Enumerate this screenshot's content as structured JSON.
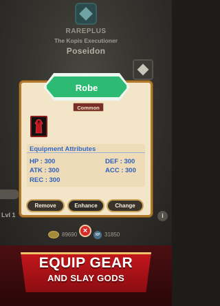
{
  "background": {
    "rarity": "RAREPLUS",
    "subtitle": "The Kopis Executioner",
    "hero_name": "Poseidon",
    "level_label": "Lvl 1",
    "info_label": "i"
  },
  "currency": {
    "gold": "89690",
    "xp_label": "XP",
    "xp": "31850"
  },
  "modal": {
    "item_name": "Robe",
    "rarity": "Common",
    "attributes_title": "Equipment Attributes",
    "stats": {
      "hp": "HP : 300",
      "def": "DEF :  300",
      "atk": "ATK : 300",
      "acc": "ACC : 300",
      "rec": "REC : 300"
    },
    "buttons": {
      "remove": "Remove",
      "enhance": "Enhance",
      "change": "Change"
    },
    "close_icon": "×"
  },
  "promo": {
    "line1": "EQUIP GEAR",
    "line2": "AND SLAY GODS"
  },
  "colors": {
    "title_banner": "#2dbb74",
    "attribute_text": "#2f5fbd",
    "modal_bg": "#f2e5c8",
    "promo_red": "#c2161b"
  }
}
